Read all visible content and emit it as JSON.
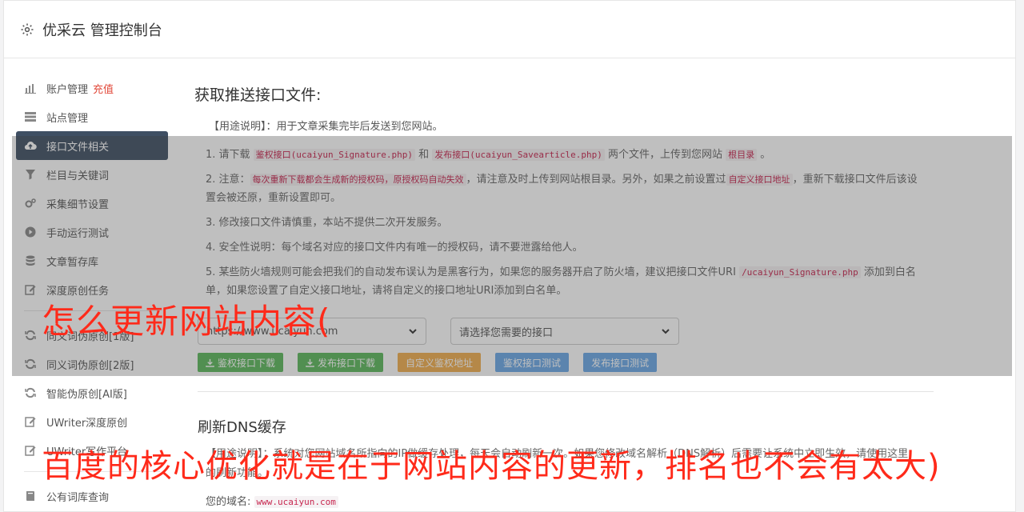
{
  "header": {
    "title": "优采云 管理控制台",
    "icon": "gear-icon"
  },
  "sidebar": {
    "items": [
      {
        "label": "账户管理",
        "extra": "充值",
        "icon": "bar-chart-icon"
      },
      {
        "label": "站点管理",
        "icon": "server-icon"
      },
      {
        "label": "接口文件相关",
        "icon": "cloud-upload-icon",
        "active": true
      },
      {
        "label": "栏目与关键词",
        "icon": "filter-icon"
      },
      {
        "label": "采集细节设置",
        "icon": "cogs-icon"
      },
      {
        "label": "手动运行测试",
        "icon": "play-circle-icon"
      },
      {
        "label": "文章暂存库",
        "icon": "database-icon"
      },
      {
        "label": "深度原创任务",
        "icon": "edit-icon"
      },
      {
        "label": "同义词伪原创[1版]",
        "icon": "refresh-icon"
      },
      {
        "label": "同义词伪原创[2版]",
        "icon": "refresh-icon"
      },
      {
        "label": "智能伪原创[AI版]",
        "icon": "refresh-icon"
      },
      {
        "label": "UWriter深度原创",
        "icon": "edit-icon"
      },
      {
        "label": "UWriter写作平台",
        "icon": "edit-icon"
      },
      {
        "label": "公有词库查询",
        "icon": "book-icon"
      }
    ]
  },
  "main": {
    "title": "获取推送接口文件:",
    "usage": "【用途说明】：用于文章采集完毕后发送到您网站。",
    "steps": {
      "s1a": "1. 请下载 ",
      "s1code1": "鉴权接口(ucaiyun_Signature.php)",
      "s1b": " 和 ",
      "s1code2": "发布接口(ucaiyun_Savearticle.php)",
      "s1c": " 两个文件，上传到您网站 ",
      "s1code3": "根目录",
      "s1d": " 。",
      "s2a": "2. 注意：",
      "s2code1": "每次重新下载都会生成新的授权码，原授权码自动失效",
      "s2b": "，请注意及时上传到网站根目录。另外，如果之前设置过",
      "s2code2": "自定义接口地址",
      "s2c": "，重新下载接口文件后该设置会被还原，重新设置即可。",
      "s3": "3. 修改接口文件请慎重，本站不提供二次开发服务。",
      "s4": "4. 安全性说明：每个域名对应的接口文件内有唯一的授权码，请不要泄露给他人。",
      "s5a": "5. 某些防火墙规则可能会把我们的自动发布误认为是黑客行为，如果您的服务器开启了防火墙，建议把接口文件URI ",
      "s5code": "/ucaiyun_Signature.php",
      "s5b": " 添加到白名单，如果您设置了自定义接口地址，请将自定义的接口地址URI添加到白名单。"
    },
    "site_select": "https://www.ucaiyun.com",
    "api_select": "请选择您需要的接口",
    "buttons": {
      "auth_download": "鉴权接口下载",
      "publish_download": "发布接口下载",
      "custom_auth": "自定义鉴权地址",
      "auth_test": "鉴权接口测试",
      "publish_test": "发布接口测试"
    },
    "dns": {
      "title": "刷新DNS缓存",
      "desc": "【用途说明】：系统对您网站域名所指向的IP做缓存处理，每天会自动刷新一次。如果您修改域名解析（DNS解析）后需要让系统中立即生效，请使用这里的刷新功能。",
      "domain_label": "您的域名:",
      "domain_value": "www.ucaiyun.com"
    }
  },
  "watermark": {
    "line1": "怎么更新网站内容(",
    "line2": "百度的核心优化就是在于网站内容的更新，排名也不会有太大)"
  },
  "colors": {
    "sidebar_active": "#3f4f63",
    "green": "#5cb85c",
    "orange": "#f0ad4e",
    "blue": "#6aa7e6",
    "code": "#c7254e",
    "watermark": "#ff2a1a"
  }
}
